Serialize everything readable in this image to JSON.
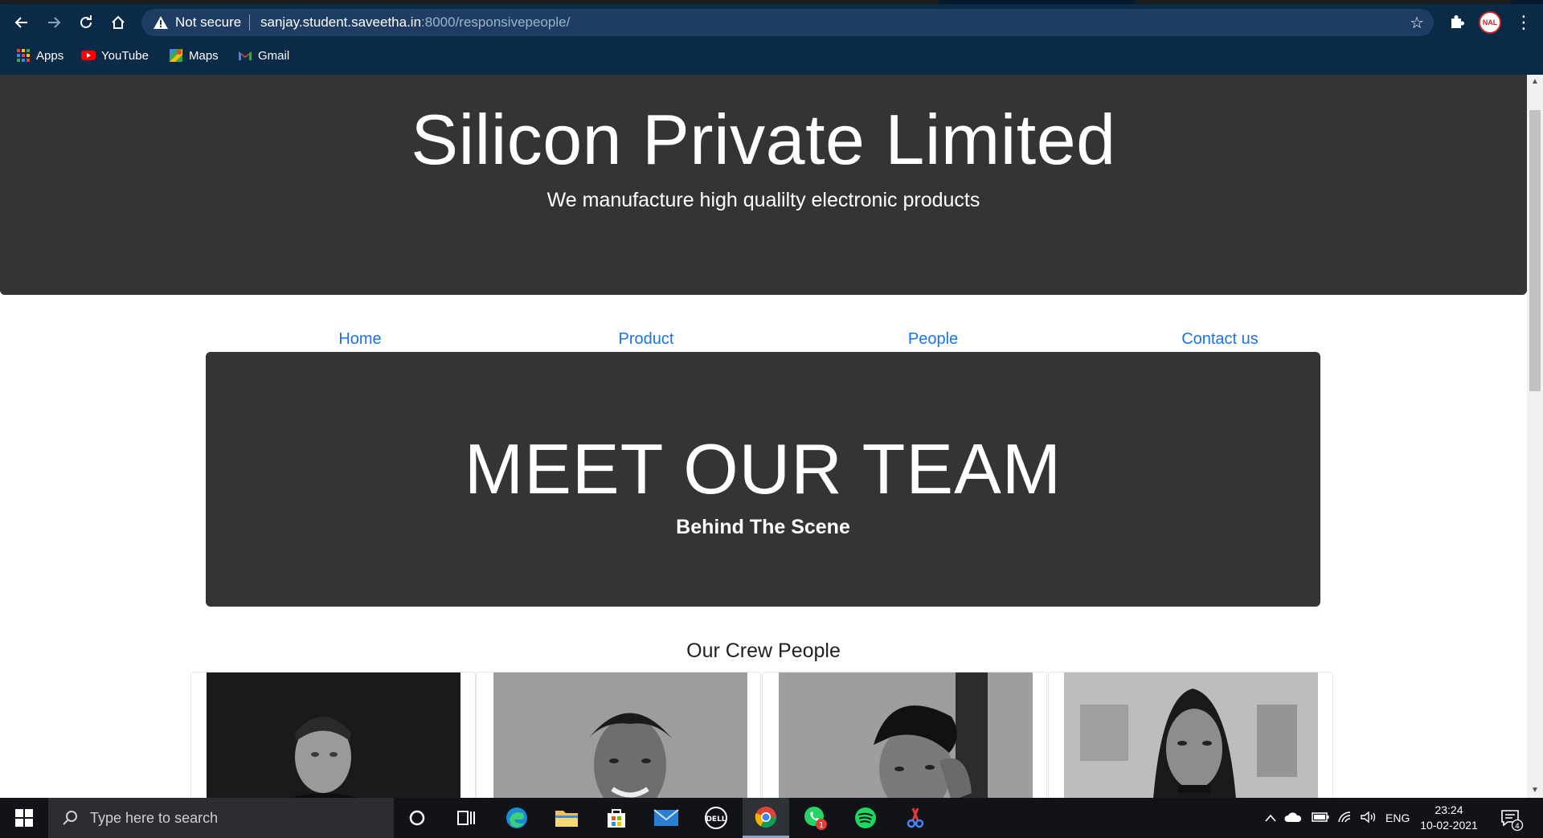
{
  "browser": {
    "security_label": "Not secure",
    "url_host": "sanjay.student.saveetha.in",
    "url_rest": ":8000/responsivepeople/",
    "profile_initials": "NAL",
    "bookmarks": [
      {
        "label": "Apps",
        "icon": "apps-grid-icon"
      },
      {
        "label": "YouTube",
        "icon": "youtube-icon"
      },
      {
        "label": "Maps",
        "icon": "maps-icon"
      },
      {
        "label": "Gmail",
        "icon": "gmail-icon"
      }
    ]
  },
  "page": {
    "hero_title": "Silicon Private Limited",
    "hero_subtitle": "We manufacture high qualilty electronic products",
    "nav": [
      "Home",
      "Product",
      "People",
      "Contact us"
    ],
    "team_title": "MEET OUR TEAM",
    "team_subtitle": "Behind The Scene",
    "crew_title": "Our Crew People",
    "crew_photos": [
      "man-suit-photo",
      "smiling-man-photo",
      "man-hand-on-head-photo",
      "woman-portrait-photo"
    ]
  },
  "taskbar": {
    "search_placeholder": "Type here to search",
    "language": "ENG",
    "time": "23:24",
    "date": "10-02-2021",
    "whatsapp_badge": "1",
    "notification_count": "4"
  },
  "colors": {
    "chrome_bg": "#0b2a48",
    "hero_bg": "#343434",
    "link": "#1a73e8",
    "taskbar_bg": "#111318"
  }
}
